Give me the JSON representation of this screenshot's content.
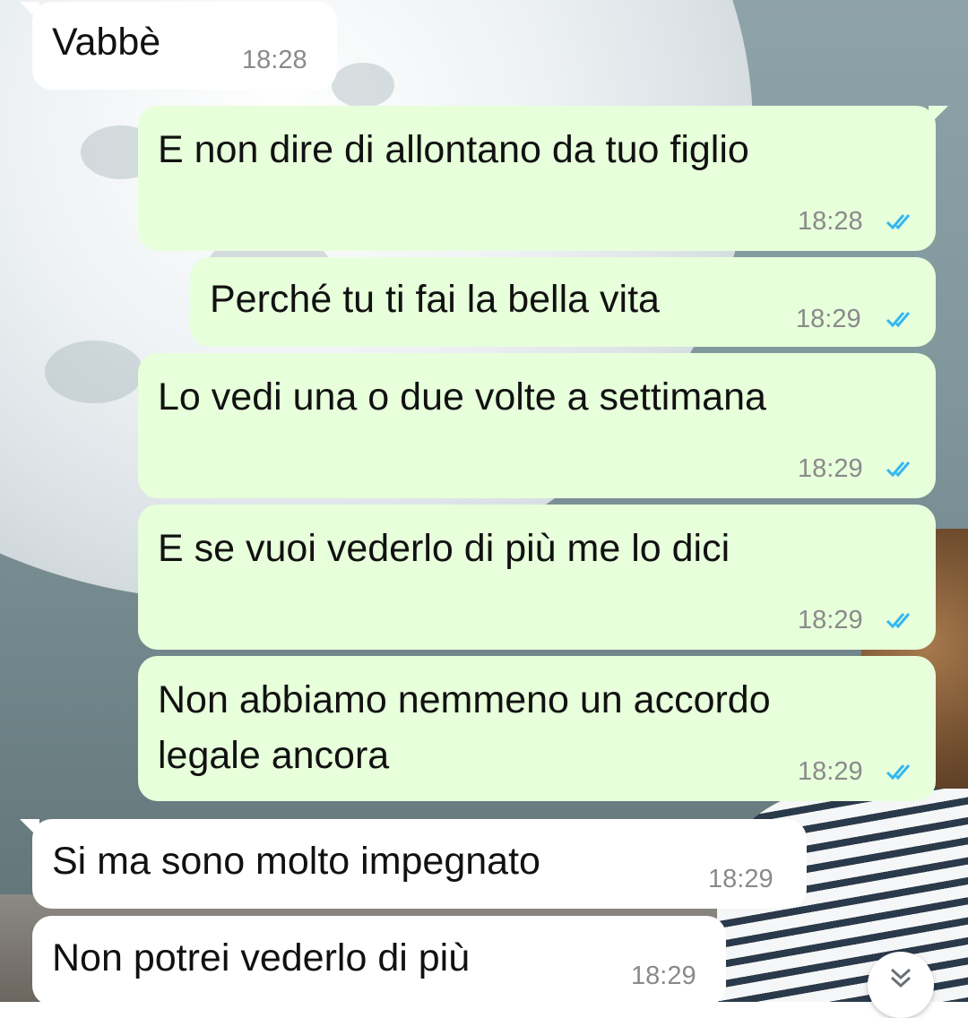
{
  "wallpaper": {
    "description_colors": {
      "sky": "#7f969b",
      "moon": "#eef2f4"
    }
  },
  "colors": {
    "incoming": "#ffffff",
    "outgoing": "#e7ffdb",
    "read_check": "#34b7f1",
    "time": "#8a8a8a"
  },
  "messages": [
    {
      "text": "Vabbè",
      "time": "18:28",
      "direction": "in"
    },
    {
      "text": "E non dire di allontano da tuo figlio",
      "time": "18:28",
      "direction": "out",
      "status": "read"
    },
    {
      "text": "Perché tu ti fai la bella vita",
      "time": "18:29",
      "direction": "out",
      "status": "read"
    },
    {
      "text": "Lo vedi una o due volte a settimana",
      "time": "18:29",
      "direction": "out",
      "status": "read"
    },
    {
      "text": "E se vuoi vederlo di più me lo dici",
      "time": "18:29",
      "direction": "out",
      "status": "read"
    },
    {
      "lines": [
        "Non abbiamo nemmeno un accordo",
        "legale ancora"
      ],
      "time": "18:29",
      "direction": "out",
      "status": "read"
    },
    {
      "text": "Si ma sono molto impegnato",
      "time": "18:29",
      "direction": "in"
    },
    {
      "text": "Non potrei vederlo di più",
      "time": "18:29",
      "direction": "in"
    }
  ],
  "scroll_button": {
    "icon": "double-chevron-down-icon"
  }
}
